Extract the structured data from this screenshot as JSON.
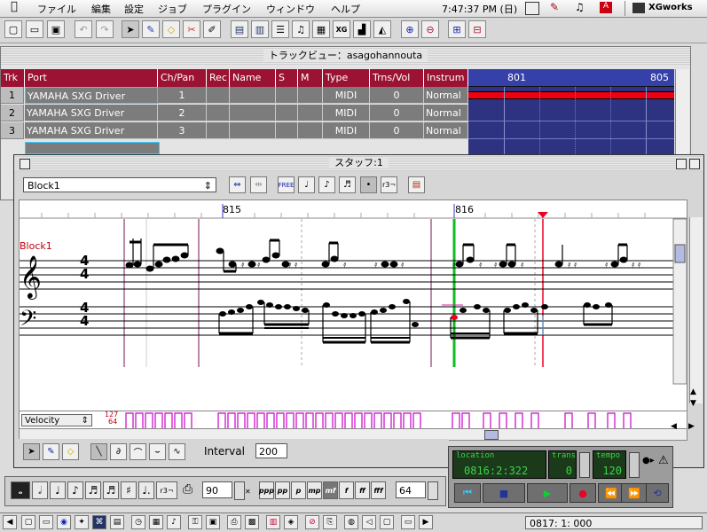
{
  "menubar": {
    "apple_icon": "apple-icon",
    "items": [
      "ファイル",
      "編集",
      "設定",
      "ジョブ",
      "プラグイン",
      "ウィンドウ",
      "ヘルプ"
    ],
    "clock": "7:47:37 PM (日)",
    "app_name": "XGworks"
  },
  "toolbar": {
    "icons": [
      "new-file-icon",
      "open-folder-icon",
      "save-icon",
      "undo-icon",
      "redo-icon",
      "pointer-icon",
      "pencil-icon",
      "eraser-icon",
      "scissors-icon",
      "glue-icon",
      "track-view-icon",
      "piano-roll-icon",
      "event-list-icon",
      "staff-icon",
      "drum-icon",
      "xg-icon",
      "mixer-icon",
      "zoom-in-icon",
      "zoom-out-icon",
      "zoom-h-in-icon",
      "zoom-h-out-icon"
    ]
  },
  "track_window": {
    "title": "トラックビュー：asagohannouta",
    "columns": [
      "Trk",
      "Port",
      "Ch/Pan",
      "Rec",
      "Name",
      "S",
      "M",
      "Type",
      "Trns/Vol",
      "Instrum"
    ],
    "rows": [
      {
        "trk": "1",
        "port": "YAMAHA SXG Driver",
        "ch": "1",
        "rec": "",
        "name": "",
        "s": "",
        "m": "",
        "type": "MIDI",
        "trns": "0",
        "instr": "Normal"
      },
      {
        "trk": "2",
        "port": "YAMAHA SXG Driver",
        "ch": "2",
        "rec": "",
        "name": "",
        "s": "",
        "m": "",
        "type": "MIDI",
        "trns": "0",
        "instr": "Normal"
      },
      {
        "trk": "3",
        "port": "YAMAHA SXG Driver",
        "ch": "3",
        "rec": "",
        "name": "",
        "s": "",
        "m": "",
        "type": "MIDI",
        "trns": "0",
        "instr": "Normal"
      }
    ],
    "timeline_marks": [
      "801",
      "805"
    ]
  },
  "staff_window": {
    "title": "スタッフ:1",
    "block_select": "Block1",
    "free_label": "FREE",
    "triplet_label": "r3¬",
    "measures": [
      "815",
      "816"
    ],
    "block_label": "Block1",
    "time_sig_top": "4",
    "time_sig_bottom": "4",
    "velocity_select": "Velocity",
    "velocity_max": "127",
    "velocity_min": "64",
    "interval_label": "Interval",
    "interval_value": "200"
  },
  "transport": {
    "location_label": "location",
    "location_value": "0816:2:322",
    "trans_label": "trans",
    "trans_value": "0",
    "tempo_label": "tempo",
    "tempo_value": "120"
  },
  "note_palette": {
    "triplet": "r3¬",
    "quantize_value": "90",
    "dynamics": [
      "ppp",
      "pp",
      "p",
      "mp",
      "mf",
      "f",
      "ff",
      "fff"
    ],
    "velocity_value": "64"
  },
  "status": {
    "position": "0817: 1: 000"
  }
}
